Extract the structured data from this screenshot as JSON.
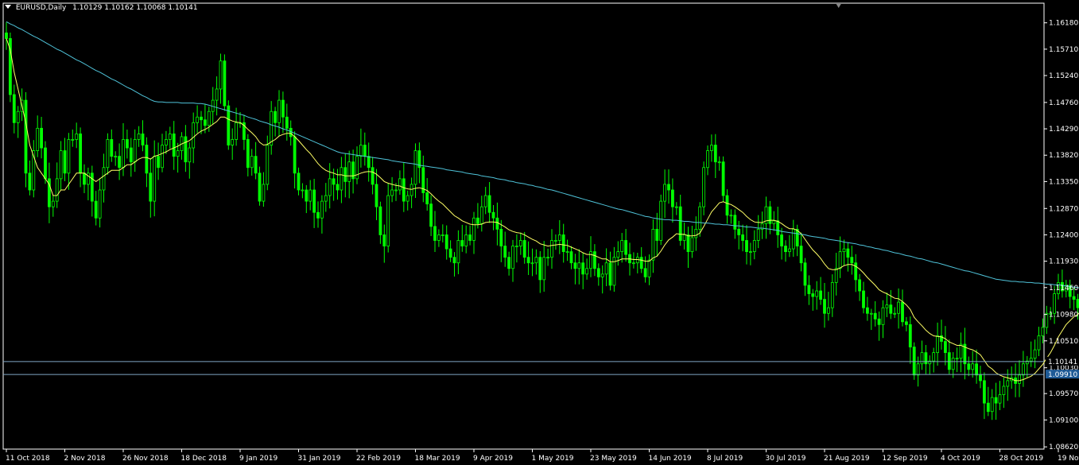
{
  "header": {
    "symbol": "EURUSD,Daily",
    "ohlc": "1.10129 1.10162 1.10068 1.10141"
  },
  "colors": {
    "background": "#000000",
    "frame": "#ffffff",
    "bull_candle": "#00ff00",
    "bear_candle": "#00ff00",
    "ma_fast": "#ffff66",
    "ma_slow": "#4fc3d9",
    "level_line": "#7fa6c4",
    "price_tag": "#1e5a96"
  },
  "chart_data": {
    "type": "line",
    "chart_style": "candlestick",
    "grid": false,
    "legend": "none",
    "ylim": [
      1.0858,
      1.1653
    ],
    "y_ticks": [
      "1.16180",
      "1.15710",
      "1.15240",
      "1.14760",
      "1.14290",
      "1.13820",
      "1.13350",
      "1.12870",
      "1.12400",
      "1.11930",
      "1.11460",
      "1.10980",
      "1.10510",
      "1.10030",
      "1.09570",
      "1.09100",
      "1.08620"
    ],
    "x_tick_labels": [
      "11 Oct 2018",
      "2 Nov 2018",
      "26 Nov 2018",
      "18 Dec 2018",
      "9 Jan 2019",
      "31 Jan 2019",
      "22 Feb 2019",
      "18 Mar 2019",
      "9 Apr 2019",
      "1 May 2019",
      "23 May 2019",
      "14 Jun 2019",
      "8 Jul 2019",
      "30 Jul 2019",
      "21 Aug 2019",
      "12 Sep 2019",
      "4 Oct 2019",
      "28 Oct 2019",
      "19 Nov 2019"
    ],
    "price_close": [
      1.159,
      1.149,
      1.144,
      1.146,
      1.148,
      1.135,
      1.132,
      1.139,
      1.143,
      1.1395,
      1.134,
      1.129,
      1.13,
      1.134,
      1.139,
      1.135,
      1.141,
      1.141,
      1.142,
      1.135,
      1.133,
      1.135,
      1.13,
      1.127,
      1.132,
      1.136,
      1.141,
      1.138,
      1.138,
      1.136,
      1.141,
      1.1395,
      1.137,
      1.141,
      1.142,
      1.14,
      1.135,
      1.13,
      1.138,
      1.136,
      1.14,
      1.141,
      1.142,
      1.138,
      1.139,
      1.1415,
      1.137,
      1.1395,
      1.144,
      1.145,
      1.1445,
      1.1435,
      1.146,
      1.148,
      1.15,
      1.155,
      1.147,
      1.14,
      1.141,
      1.144,
      1.144,
      1.141,
      1.136,
      1.138,
      1.135,
      1.13,
      1.133,
      1.14,
      1.146,
      1.144,
      1.148,
      1.145,
      1.143,
      1.1415,
      1.135,
      1.132,
      1.132,
      1.13,
      1.132,
      1.128,
      1.127,
      1.13,
      1.131,
      1.134,
      1.133,
      1.132,
      1.136,
      1.1335,
      1.137,
      1.134,
      1.138,
      1.14,
      1.138,
      1.136,
      1.133,
      1.129,
      1.124,
      1.122,
      1.131,
      1.132,
      1.132,
      1.134,
      1.13,
      1.131,
      1.133,
      1.139,
      1.136,
      1.1315,
      1.1295,
      1.1255,
      1.123,
      1.124,
      1.124,
      1.1215,
      1.12,
      1.119,
      1.123,
      1.122,
      1.124,
      1.123,
      1.127,
      1.126,
      1.129,
      1.131,
      1.128,
      1.127,
      1.125,
      1.122,
      1.12,
      1.118,
      1.122,
      1.122,
      1.123,
      1.12,
      1.119,
      1.119,
      1.12,
      1.116,
      1.12,
      1.12,
      1.123,
      1.123,
      1.124,
      1.121,
      1.121,
      1.119,
      1.118,
      1.119,
      1.117,
      1.118,
      1.121,
      1.118,
      1.1165,
      1.117,
      1.119,
      1.115,
      1.12,
      1.121,
      1.123,
      1.1205,
      1.119,
      1.119,
      1.12,
      1.118,
      1.1165,
      1.1195,
      1.125,
      1.123,
      1.13,
      1.133,
      1.132,
      1.129,
      1.129,
      1.123,
      1.124,
      1.121,
      1.1235,
      1.125,
      1.129,
      1.136,
      1.139,
      1.14,
      1.137,
      1.137,
      1.131,
      1.1275,
      1.1275,
      1.125,
      1.124,
      1.123,
      1.121,
      1.121,
      1.123,
      1.125,
      1.126,
      1.129,
      1.126,
      1.1265,
      1.124,
      1.122,
      1.121,
      1.1215,
      1.125,
      1.122,
      1.119,
      1.115,
      1.1135,
      1.113,
      1.114,
      1.1125,
      1.11,
      1.111,
      1.1155,
      1.118,
      1.121,
      1.1215,
      1.12,
      1.119,
      1.116,
      1.114,
      1.111,
      1.11,
      1.11,
      1.109,
      1.108,
      1.111,
      1.1115,
      1.11,
      1.11,
      1.112,
      1.1085,
      1.108,
      1.104,
      1.099,
      1.101,
      1.103,
      1.101,
      1.1015,
      1.103,
      1.106,
      1.105,
      1.103,
      1.1,
      1.102,
      1.102,
      1.1045,
      1.101,
      1.1,
      1.101,
      1.099,
      1.098,
      1.094,
      1.0925,
      1.095,
      1.094,
      1.0955,
      1.097,
      1.098,
      1.0985,
      1.0975,
      1.099,
      1.101,
      1.1015,
      1.102,
      1.1035,
      1.106,
      1.1075,
      1.11,
      1.11,
      1.1135,
      1.1155,
      1.114,
      1.115,
      1.113,
      1.1125,
      1.111,
      1.114,
      1.115,
      1.1155,
      1.1125,
      1.1105,
      1.1085,
      1.107,
      1.105,
      1.1035,
      1.1025,
      1.102,
      1.1015
    ],
    "current_price": 1.10141,
    "marked_level": 1.0991,
    "series": [
      {
        "role": "fast moving average",
        "values": [
          1.159,
          1.157,
          1.153,
          1.15,
          1.147,
          1.144,
          1.14,
          1.138,
          1.136,
          1.135,
          1.134,
          1.133,
          1.131,
          1.131,
          1.132,
          1.132,
          1.133,
          1.134,
          1.135,
          1.135,
          1.135,
          1.1345,
          1.134,
          1.1335,
          1.134,
          1.1345,
          1.135,
          1.1355,
          1.1355,
          1.1355,
          1.136,
          1.1365,
          1.1365,
          1.137,
          1.1375,
          1.1378,
          1.1378,
          1.1375,
          1.138,
          1.1382,
          1.1385,
          1.1388,
          1.1392,
          1.1395,
          1.1398,
          1.1402,
          1.1405,
          1.1408,
          1.1414,
          1.142,
          1.1425,
          1.1428,
          1.1432,
          1.1437,
          1.1442,
          1.145,
          1.145,
          1.1446,
          1.1443,
          1.1441,
          1.144,
          1.1435,
          1.1428,
          1.1422,
          1.1415,
          1.1405,
          1.14,
          1.1401,
          1.1406,
          1.141,
          1.1416,
          1.1419,
          1.1421,
          1.1421,
          1.1415,
          1.1408,
          1.14,
          1.1392,
          1.1385,
          1.1376,
          1.1367,
          1.136,
          1.1355,
          1.1352,
          1.135,
          1.1347,
          1.1347,
          1.1345,
          1.1345,
          1.1345,
          1.1347,
          1.135,
          1.1352,
          1.1353,
          1.1352,
          1.1348,
          1.1342,
          1.1335,
          1.1332,
          1.133,
          1.1328,
          1.1327,
          1.1324,
          1.1322,
          1.1321,
          1.1323,
          1.1324,
          1.1322,
          1.1319,
          1.1313,
          1.1306,
          1.13,
          1.1295,
          1.1288,
          1.1281,
          1.1274,
          1.127,
          1.1265,
          1.1262,
          1.1259,
          1.1258,
          1.1258,
          1.1259,
          1.1262,
          1.1263,
          1.1263,
          1.1262,
          1.1258,
          1.1254,
          1.1249,
          1.1246,
          1.1244,
          1.1243,
          1.124,
          1.1236,
          1.1232,
          1.1229,
          1.1224,
          1.1222,
          1.122,
          1.1221,
          1.1222,
          1.1223,
          1.1222,
          1.1221,
          1.1218,
          1.1215,
          1.1212,
          1.1208,
          1.1205,
          1.1205,
          1.1203,
          1.12,
          1.1197,
          1.1197,
          1.1192,
          1.1192,
          1.1194,
          1.1197,
          1.1197,
          1.1197,
          1.1196,
          1.1196,
          1.1195,
          1.1193,
          1.1193,
          1.1199,
          1.1202,
          1.1211,
          1.1222,
          1.1231,
          1.1236,
          1.1242,
          1.1241,
          1.1241,
          1.1238,
          1.1238,
          1.1239,
          1.1243,
          1.1255,
          1.1268,
          1.1281,
          1.1289,
          1.1297,
          1.1299,
          1.1296,
          1.1294,
          1.129,
          1.1285,
          1.128,
          1.1273,
          1.1267,
          1.1263,
          1.1262,
          1.1262,
          1.1265,
          1.1266,
          1.1266,
          1.1264,
          1.126,
          1.1255,
          1.1251,
          1.1251,
          1.1248,
          1.1242,
          1.1232,
          1.1222,
          1.1213,
          1.1206,
          1.1198,
          1.1188,
          1.118,
          1.1178,
          1.1178,
          1.1181,
          1.1185,
          1.1187,
          1.1187,
          1.1184,
          1.1179,
          1.1172,
          1.1164,
          1.1157,
          1.115,
          1.1142,
          1.1138,
          1.1135,
          1.1131,
          1.1127,
          1.1126,
          1.1121,
          1.1115,
          1.1107,
          1.1093,
          1.1085,
          1.1078,
          1.107,
          1.1064,
          1.106,
          1.1059,
          1.1058,
          1.1055,
          1.1049,
          1.1046,
          1.1043,
          1.1043,
          1.104,
          1.1037,
          1.1035,
          1.1031,
          1.1026,
          1.1016,
          1.1006,
          1.1001,
          1.0994,
          1.099,
          1.0987,
          1.0985,
          1.0983,
          1.098,
          1.098,
          1.0982,
          1.0985,
          1.0988,
          1.0993,
          1.1001,
          1.1009,
          1.102,
          1.103,
          1.1043,
          1.1058,
          1.1069,
          1.108,
          1.1087,
          1.1094,
          1.1098,
          1.1106,
          1.1113,
          1.1121,
          1.1123,
          1.1121,
          1.1117,
          1.111,
          1.1102,
          1.1094,
          1.1085,
          1.1077,
          1.1069
        ]
      },
      {
        "role": "slow moving average",
        "values": [
          1.162,
          1.1616,
          1.1613,
          1.1609,
          1.1606,
          1.1602,
          1.1598,
          1.1594,
          1.1591,
          1.1587,
          1.1583,
          1.1579,
          1.1575,
          1.1571,
          1.1568,
          1.1564,
          1.156,
          1.1556,
          1.1552,
          1.1549,
          1.1545,
          1.1541,
          1.1537,
          1.1533,
          1.153,
          1.1526,
          1.1522,
          1.1518,
          1.1515,
          1.1511,
          1.1507,
          1.1503,
          1.15,
          1.1496,
          1.1492,
          1.1488,
          1.1485,
          1.1481,
          1.1478,
          1.1477,
          1.1477,
          1.1476,
          1.1476,
          1.1476,
          1.1476,
          1.1475,
          1.1475,
          1.1475,
          1.1475,
          1.1474,
          1.1474,
          1.1473,
          1.1471,
          1.1469,
          1.1467,
          1.1465,
          1.1463,
          1.1461,
          1.1459,
          1.1457,
          1.1455,
          1.1453,
          1.145,
          1.1448,
          1.1446,
          1.1443,
          1.1441,
          1.1439,
          1.1436,
          1.1434,
          1.1432,
          1.1429,
          1.1427,
          1.1424,
          1.1421,
          1.1418,
          1.1415,
          1.1412,
          1.1409,
          1.1406,
          1.1403,
          1.14,
          1.1397,
          1.1394,
          1.1391,
          1.1388,
          1.1386,
          1.1385,
          1.1384,
          1.1383,
          1.1382,
          1.1381,
          1.138,
          1.1379,
          1.1378,
          1.1377,
          1.1376,
          1.1375,
          1.1374,
          1.1372,
          1.1371,
          1.137,
          1.1369,
          1.1368,
          1.1367,
          1.1366,
          1.1364,
          1.1363,
          1.1362,
          1.1361,
          1.136,
          1.1359,
          1.1358,
          1.1356,
          1.1355,
          1.1354,
          1.1353,
          1.1352,
          1.135,
          1.1349,
          1.1348,
          1.1347,
          1.1345,
          1.1344,
          1.1343,
          1.1342,
          1.134,
          1.1339,
          1.1338,
          1.1336,
          1.1335,
          1.1333,
          1.1332,
          1.1331,
          1.1329,
          1.1328,
          1.1326,
          1.1325,
          1.1323,
          1.1321,
          1.132,
          1.1318,
          1.1316,
          1.1314,
          1.1312,
          1.131,
          1.1308,
          1.1306,
          1.1304,
          1.1302,
          1.13,
          1.1298,
          1.1296,
          1.1294,
          1.1292,
          1.129,
          1.1288,
          1.1286,
          1.1285,
          1.1283,
          1.1281,
          1.1279,
          1.1277,
          1.1275,
          1.1273,
          1.1272,
          1.127,
          1.1269,
          1.1268,
          1.1267,
          1.1267,
          1.1266,
          1.1266,
          1.1265,
          1.1264,
          1.1264,
          1.1263,
          1.1262,
          1.1262,
          1.1261,
          1.1261,
          1.126,
          1.1259,
          1.1259,
          1.1258,
          1.1258,
          1.1257,
          1.1256,
          1.1256,
          1.1255,
          1.1254,
          1.1254,
          1.1253,
          1.1252,
          1.1252,
          1.1251,
          1.125,
          1.1249,
          1.1248,
          1.1246,
          1.1245,
          1.1244,
          1.1243,
          1.1242,
          1.1241,
          1.124,
          1.1238,
          1.1237,
          1.1236,
          1.1235,
          1.1234,
          1.1232,
          1.1231,
          1.123,
          1.1229,
          1.1227,
          1.1226,
          1.1225,
          1.1224,
          1.1222,
          1.1221,
          1.1219,
          1.1218,
          1.1216,
          1.1215,
          1.1213,
          1.1212,
          1.121,
          1.1208,
          1.1207,
          1.1205,
          1.1203,
          1.1202,
          1.12,
          1.1198,
          1.1197,
          1.1195,
          1.1193,
          1.1191,
          1.119,
          1.1188,
          1.1186,
          1.1184,
          1.1182,
          1.118,
          1.1178,
          1.1176,
          1.1175,
          1.1173,
          1.1171,
          1.1169,
          1.1167,
          1.1165,
          1.1163,
          1.1161,
          1.116,
          1.1159,
          1.1158,
          1.1157,
          1.1157,
          1.1156,
          1.1156,
          1.1155,
          1.1155,
          1.1154,
          1.1154,
          1.1153,
          1.1152,
          1.1152,
          1.1151,
          1.1151,
          1.115,
          1.1149,
          1.1148,
          1.1147,
          1.1146,
          1.1144,
          1.1143,
          1.1142,
          1.1141,
          1.1139,
          1.1138,
          1.1136,
          1.1134,
          1.1131,
          1.1129,
          1.1126,
          1.1123,
          1.112,
          1.1117,
          1.1114,
          1.111,
          1.1106,
          1.1102
        ]
      }
    ]
  }
}
